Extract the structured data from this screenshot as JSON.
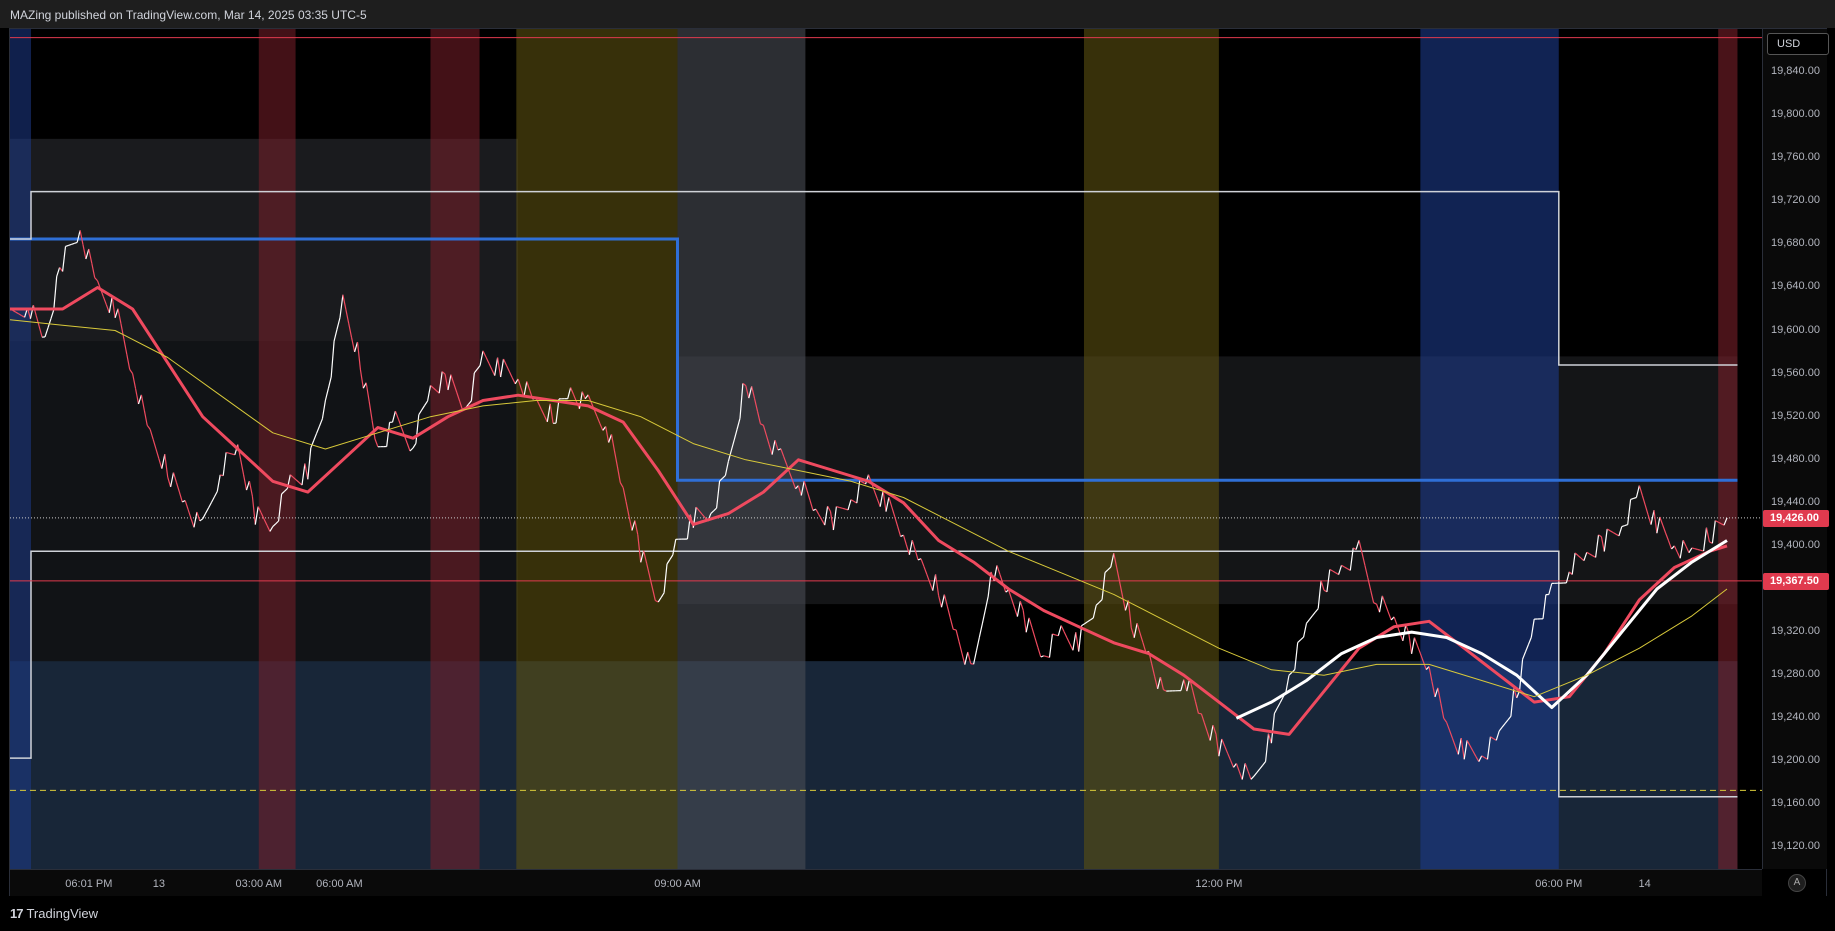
{
  "header": {
    "text": "MAZing published on TradingView.com, Mar 14, 2025 03:35 UTC-5"
  },
  "footer": {
    "logo_text": "TradingView",
    "logo_mark": "17"
  },
  "price_axis": {
    "currency": "USD",
    "auto_label": "A",
    "current_price": "19,426.00",
    "current_color": "#e03a4e",
    "line_price": "19,367.50",
    "line_color": "#e03a4e"
  },
  "colors": {
    "background": "#000000",
    "candle_up": "#ffffff",
    "candle_down": "#ef4a5f",
    "ema_fast": "#ef4a5f",
    "ema_mid": "#ffffff",
    "ema_slow": "#d8c93a",
    "thin_ma": "#9a9a9a",
    "level_blue": "#2f6fd6",
    "level_white": "#cfd2d8",
    "level_red": "#e03a4e",
    "level_yellow_dashed": "#d8c93a"
  },
  "chart_data": {
    "type": "line",
    "symbol_currency": "USD",
    "x_ticks": [
      "06:01 PM",
      "13",
      "03:00 AM",
      "06:00 AM",
      "09:00 AM",
      "12:00 PM",
      "06:00 PM",
      "14"
    ],
    "y_ticks": [
      19840,
      19800,
      19760,
      19720,
      19680,
      19640,
      19600,
      19560,
      19520,
      19480,
      19440,
      19400,
      19320,
      19280,
      19240,
      19200,
      19160,
      19120
    ],
    "y_tick_labels": [
      "19,840.00",
      "19,800.00",
      "19,760.00",
      "19,720.00",
      "19,680.00",
      "19,640.00",
      "19,600.00",
      "19,560.00",
      "19,520.00",
      "19,480.00",
      "19,440.00",
      "19,400.00",
      "19,320.00",
      "19,280.00",
      "19,240.00",
      "19,200.00",
      "19,160.00",
      "19,120.00"
    ],
    "ylim": [
      19100,
      19880
    ],
    "xlim": [
      0,
      100
    ],
    "grid": false,
    "current_price": 19426.0,
    "horizontal_lines": [
      {
        "name": "red-top-line",
        "y": 19872,
        "color": "#e03a4e",
        "x_start": 0,
        "x_end": 100
      },
      {
        "name": "red-price-line",
        "y": 19367.5,
        "color": "#e03a4e",
        "x_start": 0,
        "x_end": 100
      },
      {
        "name": "yellow-dashed-line",
        "y": 19173,
        "color": "#d8c93a",
        "dashed": true,
        "x_start": 0,
        "x_end": 100
      },
      {
        "name": "dotted-current-line",
        "y": 19426,
        "color": "#cccccc",
        "dotted": true,
        "x_start": 0,
        "x_end": 100
      }
    ],
    "step_lines": [
      {
        "name": "blue-level",
        "color": "#2f6fd6",
        "points": [
          [
            0,
            19685
          ],
          [
            38.1,
            19685
          ],
          [
            38.1,
            19461
          ],
          [
            98.6,
            19461
          ]
        ]
      },
      {
        "name": "white-upper-level",
        "color": "#cfd2d8",
        "points": [
          [
            0,
            19685
          ],
          [
            1.2,
            19685
          ],
          [
            1.2,
            19729
          ],
          [
            88.4,
            19729
          ],
          [
            88.4,
            19568
          ],
          [
            98.6,
            19568
          ]
        ]
      },
      {
        "name": "white-lower-level",
        "color": "#cfd2d8",
        "points": [
          [
            0,
            19203
          ],
          [
            1.2,
            19203
          ],
          [
            1.2,
            19395
          ],
          [
            88.4,
            19395
          ],
          [
            88.4,
            19167
          ],
          [
            98.6,
            19167
          ]
        ]
      }
    ],
    "session_bands": [
      {
        "x0": 0.0,
        "x1": 1.2,
        "color": "#1d3a8a",
        "opacity": 0.55
      },
      {
        "x0": 14.2,
        "x1": 16.3,
        "color": "#7a1f2a",
        "opacity": 0.55
      },
      {
        "x0": 24.0,
        "x1": 26.8,
        "color": "#7a1f2a",
        "opacity": 0.55
      },
      {
        "x0": 28.9,
        "x1": 38.1,
        "color": "#5c5010",
        "opacity": 0.6
      },
      {
        "x0": 38.1,
        "x1": 45.4,
        "color": "#4a4d55",
        "opacity": 0.6
      },
      {
        "x0": 61.3,
        "x1": 69.0,
        "color": "#5c5010",
        "opacity": 0.6
      },
      {
        "x0": 80.5,
        "x1": 88.4,
        "color": "#1d3a8a",
        "opacity": 0.6
      },
      {
        "x0": 97.5,
        "x1": 98.6,
        "color": "#7a1f2a",
        "opacity": 0.6
      }
    ],
    "zones": [
      {
        "x0": 0,
        "x1": 29.0,
        "y0": 19590,
        "y1": 19778,
        "color": "#3a3c42",
        "opacity": 0.45
      },
      {
        "x0": 0,
        "x1": 29.0,
        "y0": 19293,
        "y1": 19590,
        "color": "#1f2228",
        "opacity": 0.55
      },
      {
        "x0": 38.1,
        "x1": 98.6,
        "y0": 19346,
        "y1": 19576,
        "color": "#3a3c42",
        "opacity": 0.35
      },
      {
        "x0": 0,
        "x1": 98.6,
        "y0": 19100,
        "y1": 19293,
        "color": "#2b4566",
        "opacity": 0.55
      }
    ],
    "series": [
      {
        "name": "price",
        "color": "#ffffff",
        "x": [
          0,
          1,
          2,
          3,
          4,
          5,
          6,
          7,
          8,
          9,
          10,
          11,
          12,
          13,
          14,
          15,
          16,
          17,
          18,
          19,
          20,
          21,
          22,
          23,
          24,
          25,
          26,
          27,
          28,
          29,
          30,
          31,
          32,
          33,
          34,
          35,
          36,
          37,
          38,
          39,
          40,
          41,
          42,
          43,
          44,
          45,
          46,
          47,
          48,
          49,
          50,
          51,
          52,
          53,
          54,
          55,
          56,
          57,
          58,
          59,
          60,
          61,
          62,
          63,
          64,
          65,
          66,
          67,
          68,
          69,
          70,
          71,
          72,
          73,
          74,
          75,
          76,
          77,
          78,
          79,
          80,
          81,
          82,
          83,
          84,
          85,
          86,
          87,
          88,
          89,
          90,
          91,
          92,
          93,
          94,
          95,
          96,
          97,
          98
        ],
        "values": [
          19610,
          19625,
          19590,
          19665,
          19695,
          19640,
          19620,
          19560,
          19500,
          19470,
          19440,
          19415,
          19470,
          19490,
          19430,
          19420,
          19460,
          19470,
          19535,
          19625,
          19570,
          19490,
          19515,
          19495,
          19545,
          19555,
          19530,
          19575,
          19565,
          19555,
          19530,
          19520,
          19545,
          19530,
          19515,
          19450,
          19395,
          19350,
          19400,
          19425,
          19430,
          19470,
          19555,
          19510,
          19480,
          19460,
          19430,
          19425,
          19445,
          19460,
          19440,
          19410,
          19380,
          19360,
          19320,
          19280,
          19380,
          19355,
          19330,
          19300,
          19320,
          19310,
          19345,
          19385,
          19330,
          19300,
          19255,
          19280,
          19240,
          19215,
          19200,
          19180,
          19225,
          19280,
          19320,
          19365,
          19380,
          19395,
          19350,
          19330,
          19310,
          19290,
          19230,
          19210,
          19205,
          19220,
          19265,
          19330,
          19355,
          19380,
          19390,
          19405,
          19420,
          19450,
          19420,
          19400,
          19390,
          19410,
          19426
        ],
        "stroke_width": 1
      },
      {
        "name": "ema-fast",
        "color": "#ef4a5f",
        "x": [
          0,
          3,
          5,
          7,
          9,
          11,
          13,
          15,
          17,
          19,
          21,
          23,
          25,
          27,
          29,
          31,
          33,
          35,
          37,
          39,
          41,
          43,
          45,
          47,
          49,
          51,
          53,
          55,
          57,
          59,
          61,
          63,
          65,
          67,
          69,
          71,
          73,
          75,
          77,
          79,
          81,
          83,
          85,
          87,
          89,
          91,
          93,
          95,
          97,
          98
        ],
        "values": [
          19620,
          19620,
          19640,
          19620,
          19570,
          19520,
          19490,
          19460,
          19450,
          19480,
          19510,
          19500,
          19520,
          19535,
          19540,
          19535,
          19530,
          19515,
          19470,
          19420,
          19430,
          19450,
          19480,
          19470,
          19460,
          19440,
          19405,
          19385,
          19360,
          19340,
          19325,
          19310,
          19300,
          19280,
          19255,
          19230,
          19225,
          19265,
          19305,
          19325,
          19330,
          19305,
          19280,
          19255,
          19260,
          19300,
          19350,
          19380,
          19395,
          19400
        ],
        "stroke_width": 3
      },
      {
        "name": "ema-mid",
        "color": "#ffffff",
        "x": [
          70,
          72,
          74,
          76,
          78,
          80,
          82,
          84,
          86,
          88,
          90,
          92,
          94,
          96,
          98
        ],
        "values": [
          19240,
          19255,
          19275,
          19300,
          19315,
          19320,
          19315,
          19300,
          19280,
          19250,
          19280,
          19320,
          19360,
          19385,
          19405
        ],
        "stroke_width": 3
      },
      {
        "name": "ema-slow",
        "color": "#d8c93a",
        "x": [
          0,
          3,
          6,
          9,
          12,
          15,
          18,
          21,
          24,
          27,
          30,
          33,
          36,
          39,
          42,
          45,
          48,
          51,
          54,
          57,
          60,
          63,
          66,
          69,
          72,
          75,
          78,
          81,
          84,
          87,
          90,
          93,
          96,
          98
        ],
        "values": [
          19610,
          19605,
          19600,
          19575,
          19540,
          19505,
          19490,
          19505,
          19520,
          19530,
          19535,
          19535,
          19520,
          19495,
          19480,
          19470,
          19460,
          19445,
          19420,
          19395,
          19375,
          19355,
          19330,
          19305,
          19285,
          19280,
          19290,
          19290,
          19275,
          19260,
          19280,
          19305,
          19335,
          19360
        ],
        "stroke_width": 1
      }
    ]
  }
}
